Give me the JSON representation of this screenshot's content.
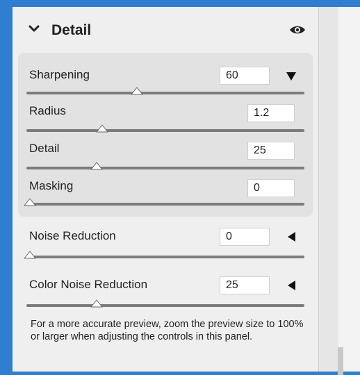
{
  "panel": {
    "title": "Detail",
    "icons": {
      "collapse": "chevron-down-icon",
      "visibility": "eye-icon"
    }
  },
  "sharpening": {
    "sharpening": {
      "label": "Sharpening",
      "value": "60",
      "slider_fraction": 0.4,
      "menu_icon": "triangle-down-icon"
    },
    "radius": {
      "label": "Radius",
      "value": "1.2",
      "slider_fraction": 0.27
    },
    "detail": {
      "label": "Detail",
      "value": "25",
      "slider_fraction": 0.25
    },
    "masking": {
      "label": "Masking",
      "value": "0",
      "slider_fraction": 0.0
    }
  },
  "noise": {
    "luminance": {
      "label": "Noise Reduction",
      "value": "0",
      "slider_fraction": 0.0,
      "expand_icon": "triangle-left-icon"
    },
    "color": {
      "label": "Color Noise Reduction",
      "value": "25",
      "slider_fraction": 0.25,
      "expand_icon": "triangle-left-icon"
    }
  },
  "hint_text": "For a more accurate preview, zoom the preview size to 100% or larger when adjusting the controls in this panel.",
  "colors": {
    "frame": "#2f7fd0",
    "panel": "#efefef",
    "group": "#e2e2e2",
    "track": "#7c7c7c"
  }
}
